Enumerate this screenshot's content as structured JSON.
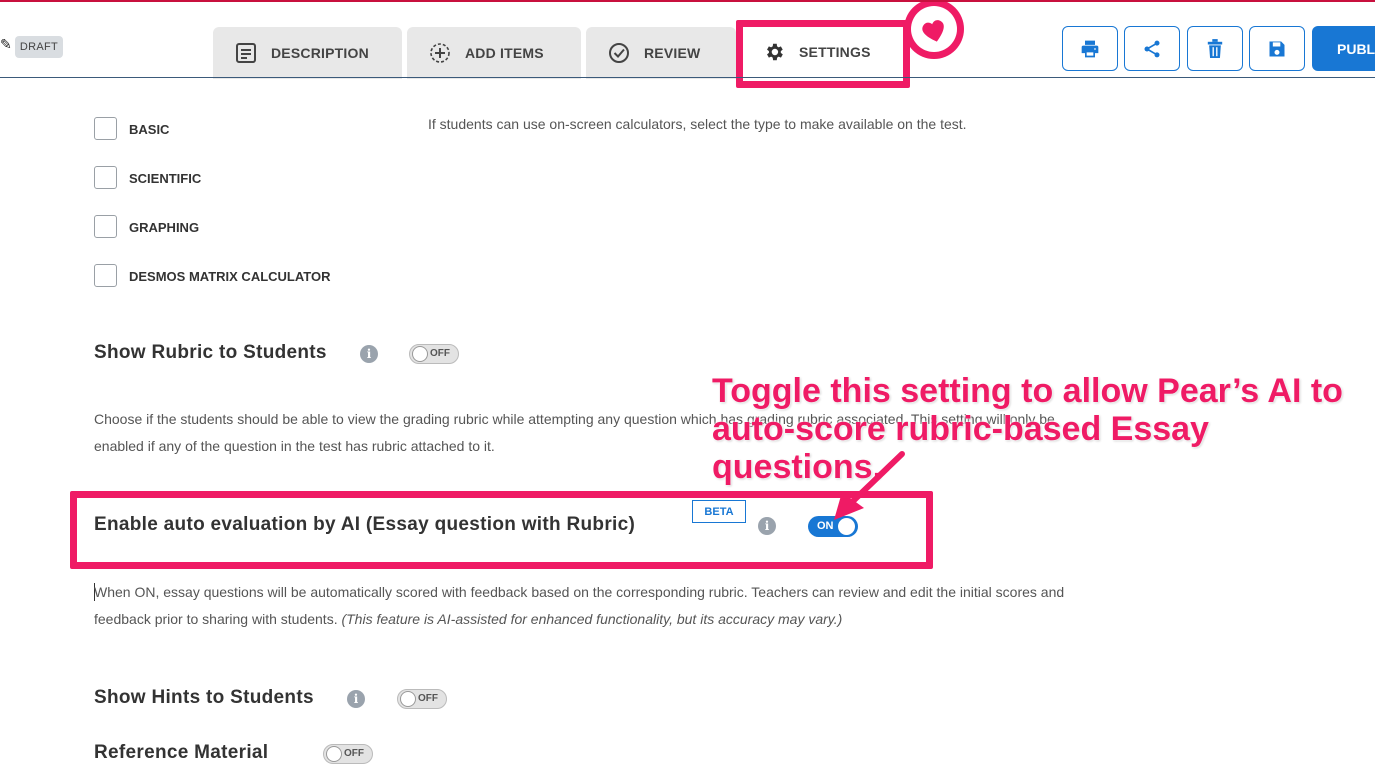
{
  "header": {
    "draft_badge": "DRAFT",
    "tabs": [
      {
        "label": "DESCRIPTION",
        "icon": "description-icon"
      },
      {
        "label": "ADD ITEMS",
        "icon": "add-circle-icon"
      },
      {
        "label": "REVIEW",
        "icon": "check-circle-icon"
      },
      {
        "label": "SETTINGS",
        "icon": "gear-icon",
        "active": true
      }
    ],
    "actions": [
      "print-icon",
      "share-icon",
      "trash-icon",
      "save-icon"
    ],
    "publish_label": "PUBLI"
  },
  "calculators": {
    "options": [
      "BASIC",
      "SCIENTIFIC",
      "GRAPHING",
      "DESMOS MATRIX CALCULATOR"
    ],
    "help_text": "If students can use on-screen calculators, select the type to make available on the test."
  },
  "rubric_setting": {
    "title": "Show Rubric to Students",
    "toggle": "OFF",
    "description": "Choose if the students should be able to view the grading rubric while attempting any question which has grading rubric associated. This setting will only be enabled if any of the question in the test has rubric attached to it."
  },
  "ai_setting": {
    "title": "Enable auto evaluation by AI (Essay question with Rubric)",
    "badge": "BETA",
    "toggle": "ON",
    "description": "When ON, essay questions will be automatically scored with feedback based on the corresponding rubric. Teachers can review and edit the initial scores and feedback prior to sharing with students.",
    "description_note": "(This feature is AI-assisted for enhanced functionality, but its accuracy may vary.)"
  },
  "hints_setting": {
    "title": "Show Hints to Students",
    "toggle": "OFF"
  },
  "reference_setting": {
    "title": "Reference Material",
    "toggle": "OFF"
  },
  "annotation": {
    "line1": "Toggle this setting to allow Pear’s AI to",
    "line2": "auto-score rubric-based Essay questions.",
    "color": "#ef1b65"
  }
}
